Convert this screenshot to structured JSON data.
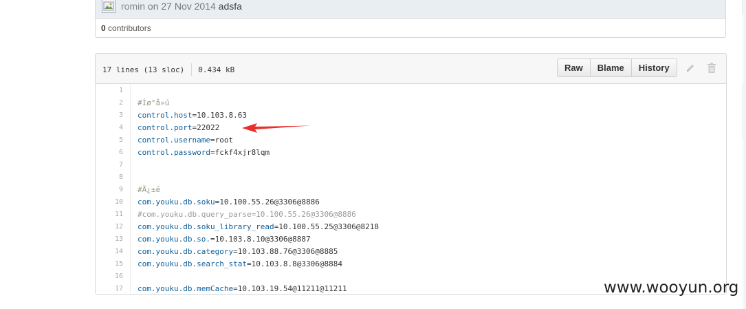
{
  "commit": {
    "author": "romin",
    "date_text": "on 27 Nov 2014",
    "message": "adsfa",
    "contributors_count": "0",
    "contributors_label": "contributors"
  },
  "file": {
    "lines_info": "17 lines (13 sloc)",
    "size": "0.434 kB",
    "buttons": {
      "raw": "Raw",
      "blame": "Blame",
      "history": "History"
    },
    "icons": [
      "pencil-icon",
      "trash-icon"
    ],
    "lines": [
      {
        "n": "1",
        "text": ""
      },
      {
        "n": "2",
        "text": "#Ìø°å»ú"
      },
      {
        "n": "3",
        "key": "control.host",
        "val": "=10.103.8.63"
      },
      {
        "n": "4",
        "key": "control.port",
        "val": "=22022"
      },
      {
        "n": "5",
        "key": "control.username",
        "val": "=root"
      },
      {
        "n": "6",
        "key": "control.password",
        "val": "=fckf4xjr8lqm"
      },
      {
        "n": "7",
        "text": ""
      },
      {
        "n": "8",
        "text": ""
      },
      {
        "n": "9",
        "text": "#Ä¿±ê"
      },
      {
        "n": "10",
        "key": "com.youku.db.soku",
        "val": "=10.100.55.26@3306@8886"
      },
      {
        "n": "11",
        "text": "#com.youku.db.query_parse=10.100.55.26@3306@8886"
      },
      {
        "n": "12",
        "key": "com.youku.db.soku_library_read",
        "val": "=10.100.55.25@3306@8218"
      },
      {
        "n": "13",
        "key": "com.youku.db.so.",
        "val": "=10.103.8.10@3306@8887"
      },
      {
        "n": "14",
        "key": "com.youku.db.category",
        "val": "=10.103.88.76@3306@8885"
      },
      {
        "n": "15",
        "key": "com.youku.db.search_stat",
        "val": "=10.103.8.8@3306@8884"
      },
      {
        "n": "16",
        "text": ""
      },
      {
        "n": "17",
        "key": "com.youku.db.memCache",
        "val": "=10.103.19.54@11211@11211"
      }
    ]
  },
  "annotation": {
    "arrow_color": "#e8302a",
    "points_to_line": "4"
  },
  "watermark": "www.wooyun.org",
  "colors": {
    "key": "#0e5e9a",
    "comment": "#999999",
    "header_bg": "#e9eef2"
  }
}
